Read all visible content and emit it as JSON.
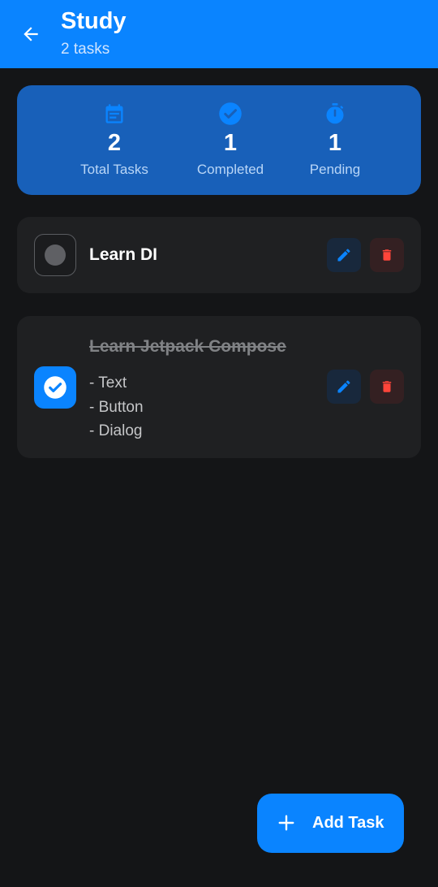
{
  "header": {
    "title": "Study",
    "subtitle": "2 tasks",
    "back_icon": "arrow-left-icon",
    "background": "#0a84ff"
  },
  "stats": [
    {
      "icon": "calendar-icon",
      "value": "2",
      "label": "Total Tasks"
    },
    {
      "icon": "check-circle-icon",
      "value": "1",
      "label": "Completed"
    },
    {
      "icon": "timer-icon",
      "value": "1",
      "label": "Pending"
    }
  ],
  "tasks": [
    {
      "title": "Learn DI",
      "completed": false,
      "notes": []
    },
    {
      "title": "Learn Jetpack Compose",
      "completed": true,
      "notes": [
        "- Text",
        "- Button",
        "- Dialog"
      ]
    }
  ],
  "actions": {
    "edit_icon": "pencil-icon",
    "delete_icon": "trash-icon"
  },
  "fab": {
    "icon": "plus-icon",
    "label": "Add Task"
  },
  "colors": {
    "accent": "#0a84ff",
    "stats_card": "#1860b9",
    "background": "#141517",
    "card": "#1f2022",
    "delete": "#ff453a"
  }
}
